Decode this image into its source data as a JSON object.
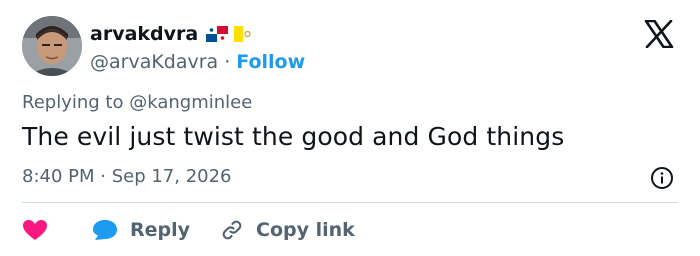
{
  "author": {
    "display_name": "arvakdvra",
    "handle": "@arvaKdavra",
    "separator": "·",
    "follow_label": "Follow",
    "flags": [
      "panama-flag-icon",
      "vatican-flag-icon"
    ]
  },
  "tweet": {
    "replying_prefix": "Replying to",
    "replying_to": "@kangminlee",
    "text": "The evil just twist the good and God things",
    "timestamp": "8:40 PM · Sep 17, 2026"
  },
  "actions": {
    "reply_label": "Reply",
    "copy_link_label": "Copy link"
  },
  "colors": {
    "accent": "#1d9bf0",
    "heart": "#f91880",
    "secondary_text": "#536471",
    "primary_text": "#0f1419",
    "divider": "#cfd9de"
  },
  "icons": {
    "logo": "x-logo-icon",
    "info": "info-icon",
    "like": "heart-icon",
    "reply": "reply-bubble-icon",
    "copy": "link-icon"
  }
}
